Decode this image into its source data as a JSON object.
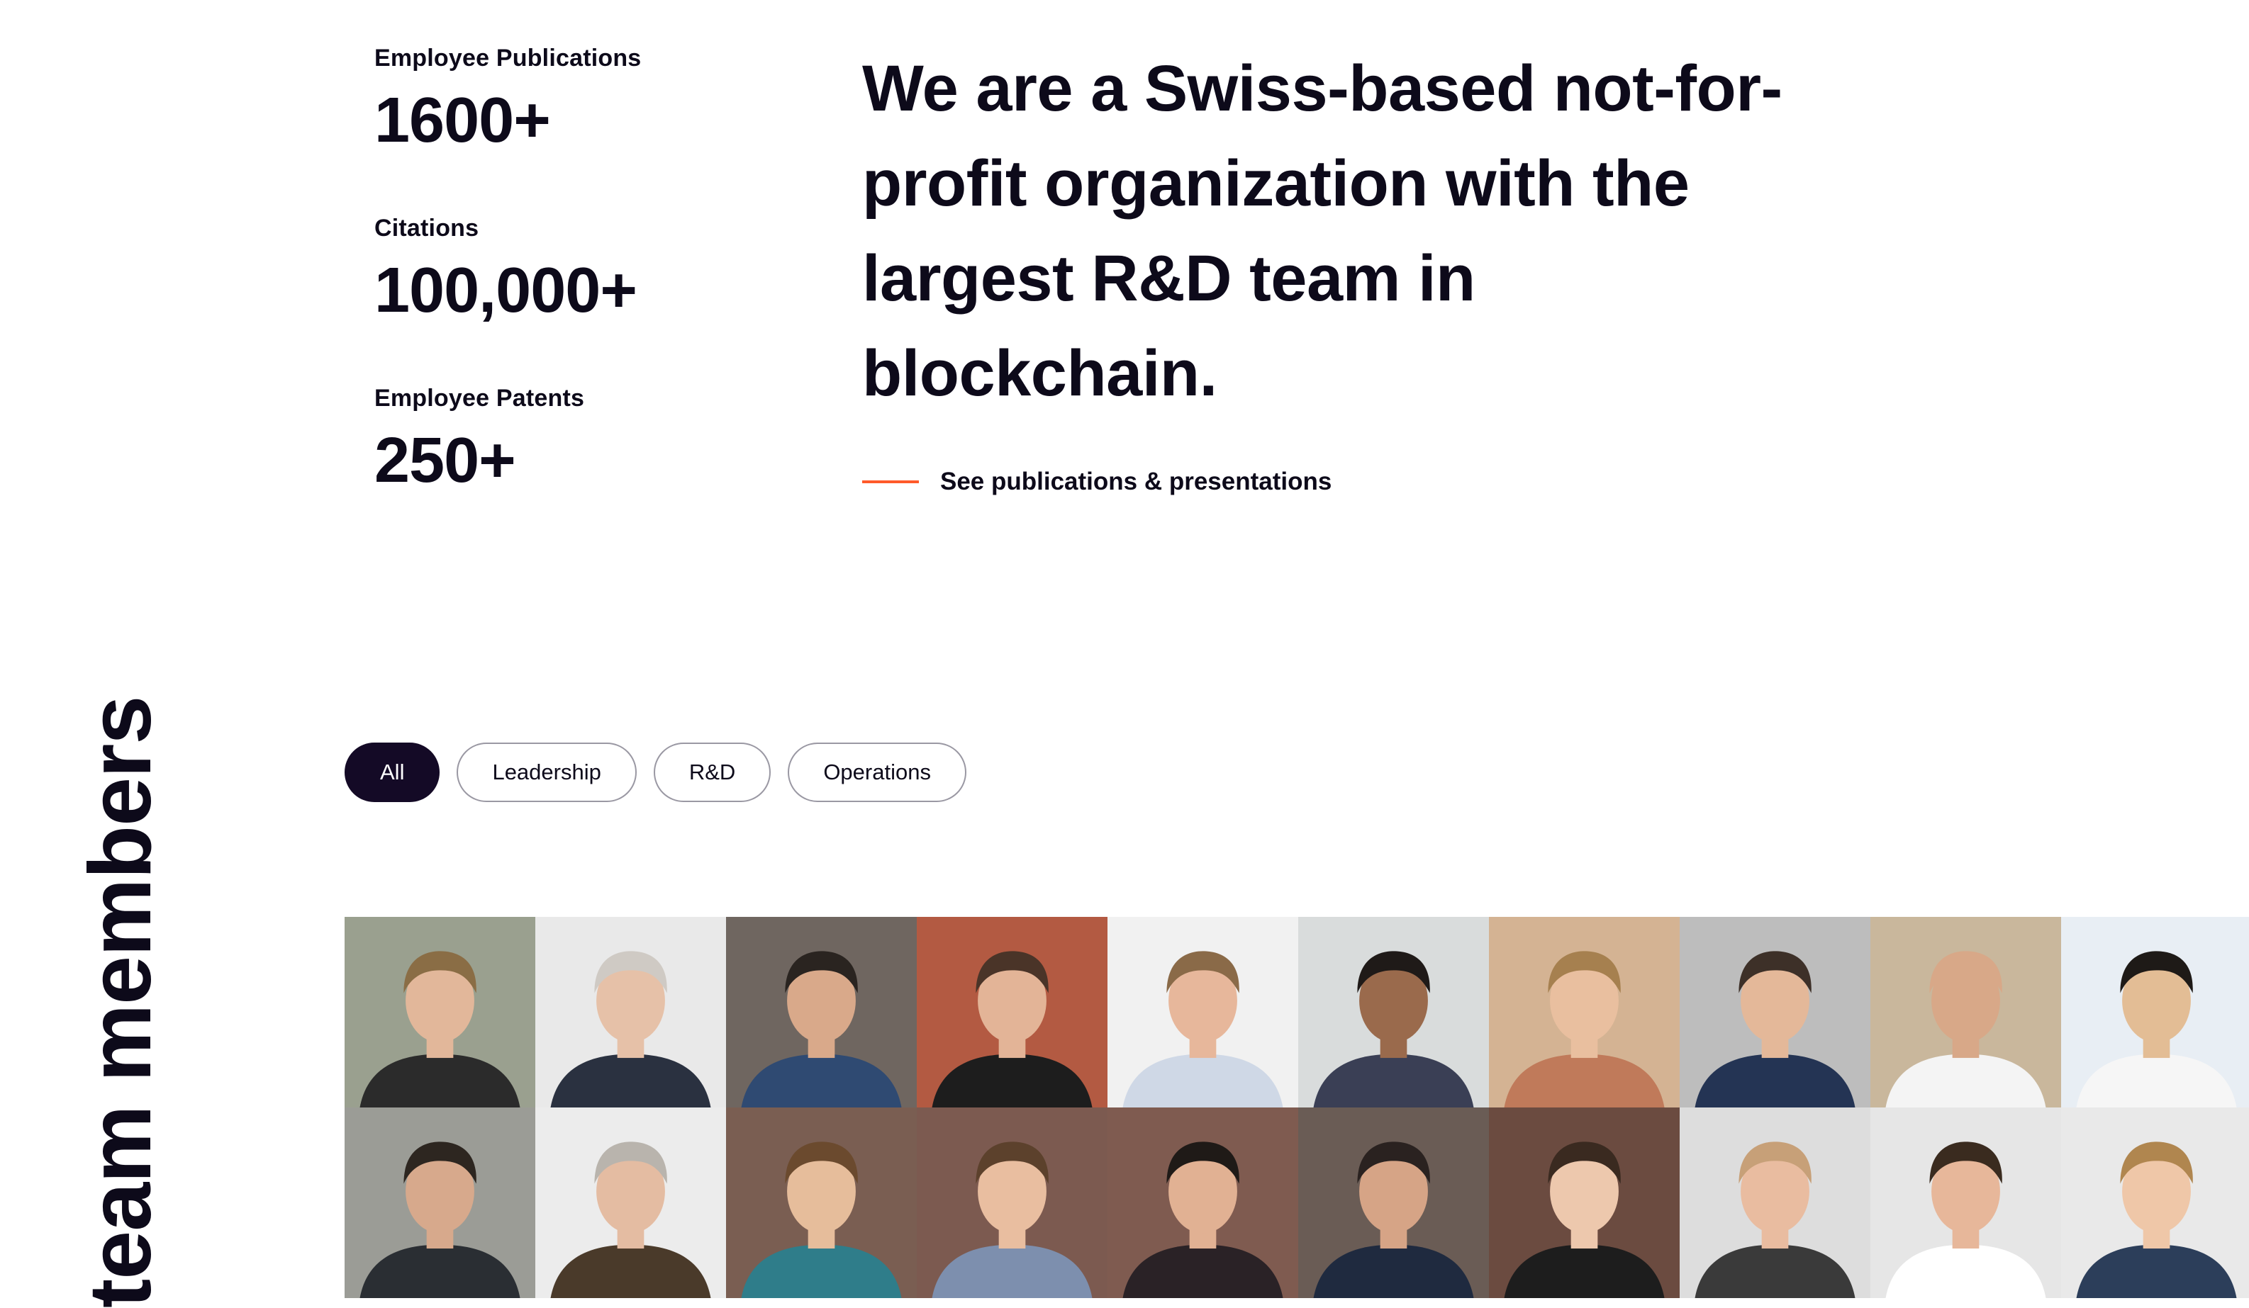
{
  "stats": [
    {
      "label": "Employee Publications",
      "value": "1600+"
    },
    {
      "label": "Citations",
      "value": "100,000+"
    },
    {
      "label": "Employee Patents",
      "value": "250+"
    }
  ],
  "intro": {
    "headline": "We are a Swiss-based not-for-profit organization with the largest R&D team in blockchain.",
    "link_label": "See publications & presentations",
    "accent_color": "#ff5a2a"
  },
  "team": {
    "section_title": "team members",
    "filters": [
      {
        "label": "All",
        "active": true
      },
      {
        "label": "Leadership",
        "active": false
      },
      {
        "label": "R&D",
        "active": false
      },
      {
        "label": "Operations",
        "active": false
      }
    ],
    "photo_rows": [
      [
        {
          "bg": "#9aa08f",
          "skin": "#e2b79a",
          "hair": "#8a6d45",
          "shirt": "#2b2b2b"
        },
        {
          "bg": "#e9e9e9",
          "skin": "#e6c1a8",
          "hair": "#cfcac4",
          "shirt": "#2a3140"
        },
        {
          "bg": "#6f6660",
          "skin": "#d9a98a",
          "hair": "#2a2420",
          "shirt": "#2f4a72"
        },
        {
          "bg": "#b35a42",
          "skin": "#e3b497",
          "hair": "#4a3428",
          "shirt": "#1d1d1d"
        },
        {
          "bg": "#f1f1f1",
          "skin": "#e7b79b",
          "hair": "#8a6a48",
          "shirt": "#cfd8e6"
        },
        {
          "bg": "#d9dcdc",
          "skin": "#9a6a4c",
          "hair": "#1f1a18",
          "shirt": "#3a3f55"
        },
        {
          "bg": "#d4b393",
          "skin": "#e9bf9f",
          "hair": "#a6804f",
          "shirt": "#c07a5a"
        },
        {
          "bg": "#bdbdbd",
          "skin": "#e4b899",
          "hair": "#3d3028",
          "shirt": "#243454"
        },
        {
          "bg": "#c9b79c",
          "skin": "#d8a888",
          "hair": "#d8a888",
          "shirt": "#f4f4f4"
        },
        {
          "bg": "#e8eef4",
          "skin": "#e3bd95",
          "hair": "#1e1a17",
          "shirt": "#f6f6f6"
        }
      ],
      [
        {
          "bg": "#9b9c96",
          "skin": "#d7a98c",
          "hair": "#2d2620",
          "shirt": "#2a2e33"
        },
        {
          "bg": "#ececec",
          "skin": "#e4bca2",
          "hair": "#b9b4ad",
          "shirt": "#4a3a2a"
        },
        {
          "bg": "#7a5e52",
          "skin": "#e6bd9b",
          "hair": "#6b4a2e",
          "shirt": "#2f7d8a"
        },
        {
          "bg": "#7c5a50",
          "skin": "#e9bea0",
          "hair": "#5c412c",
          "shirt": "#7d8fae"
        },
        {
          "bg": "#7f5b50",
          "skin": "#e1b193",
          "hair": "#1f1a17",
          "shirt": "#2a2226"
        },
        {
          "bg": "#6a5c55",
          "skin": "#d6a486",
          "hair": "#2a2220",
          "shirt": "#1f2a3f"
        },
        {
          "bg": "#6b4b40",
          "skin": "#edc8ad",
          "hair": "#3a2a20",
          "shirt": "#1d1d1d"
        },
        {
          "bg": "#dddddd",
          "skin": "#e9bca0",
          "hair": "#c7a078",
          "shirt": "#3a3a3a"
        },
        {
          "bg": "#e6e6e6",
          "skin": "#e7b79a",
          "hair": "#3a2b1f",
          "shirt": "#ffffff"
        },
        {
          "bg": "#e9e9e9",
          "skin": "#efc7a8",
          "hair": "#b0864f",
          "shirt": "#2c3e5a"
        }
      ]
    ]
  }
}
